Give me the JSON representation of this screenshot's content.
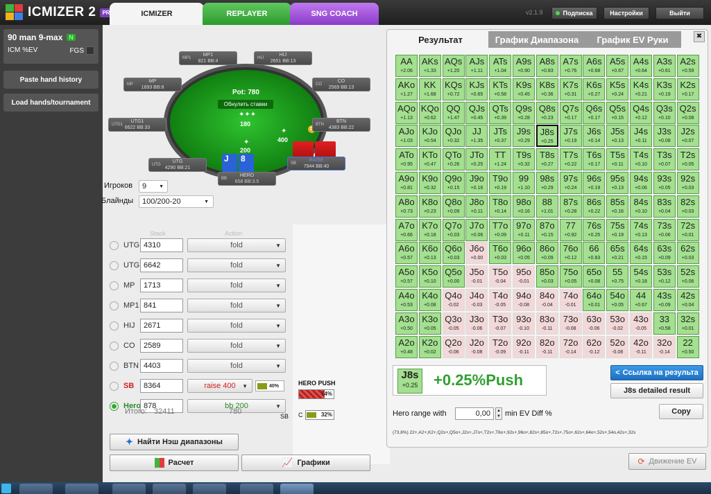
{
  "app": {
    "name": "ICMIZER 2",
    "badge": "PRO",
    "version": "v2.1.9"
  },
  "tabs": [
    "ICMIZER",
    "REPLAYER",
    "SNG COACH"
  ],
  "top_buttons": {
    "subscription": "Подписка",
    "settings": "Настройки",
    "logout": "Выйти"
  },
  "colors": {
    "green": "#4cb84c",
    "purple": "#a04fd8",
    "range_green": "#a3e08f",
    "push_text": "#2fa02f",
    "raise_red": "#d22020"
  },
  "sidebar": {
    "title": "90 man 9-max",
    "title_badge": "N",
    "sub_left": "ICM %EV",
    "sub_right": "FGS",
    "paste_button": "Paste hand history",
    "load_button": "Load hands/tournament"
  },
  "table": {
    "pot": "Pot: 780",
    "reset": "Обнулить ставки",
    "chips_center": "180",
    "chips_sb": "200",
    "chips_bb": "400",
    "dealer": "D",
    "seats": {
      "mp1": {
        "name": "MP1",
        "stack": "821 BB:4"
      },
      "hij": {
        "name": "HIJ",
        "stack": "2651 BB:13"
      },
      "mp": {
        "name": "MP",
        "stack": "1693 BB:8"
      },
      "co": {
        "name": "CO",
        "stack": "2569 BB:13"
      },
      "utg1": {
        "name": "UTG1",
        "stack": "6622 BB:33"
      },
      "btn": {
        "name": "BTN",
        "stack": "4383 BB:22"
      },
      "utg": {
        "name": "UTG",
        "stack": "4290 BB:21"
      },
      "sb": {
        "name": "RAISE",
        "stack": "7944 BB:40",
        "pos": "SB"
      },
      "hero": {
        "name": "HERO",
        "stack": "658 BB:3.5",
        "pos": "BB",
        "card1": "J",
        "card2": "8"
      }
    }
  },
  "settings": {
    "players_label": "Игроков",
    "players_value": "9",
    "blinds_label": "Блайнды",
    "blinds_value": "100/200-20"
  },
  "actions_table": {
    "stack_header": "Stack",
    "action_header": "Action",
    "rows": [
      {
        "pos": "UTG",
        "stack": "4310",
        "action": "fold"
      },
      {
        "pos": "UTG1",
        "stack": "6642",
        "action": "fold"
      },
      {
        "pos": "MP",
        "stack": "1713",
        "action": "fold"
      },
      {
        "pos": "MP1",
        "stack": "841",
        "action": "fold"
      },
      {
        "pos": "HIJ",
        "stack": "2671",
        "action": "fold"
      },
      {
        "pos": "CO",
        "stack": "2589",
        "action": "fold"
      },
      {
        "pos": "BTN",
        "stack": "4403",
        "action": "fold"
      },
      {
        "pos": "SB",
        "stack": "8364",
        "action": "raise 400",
        "pct": "40%"
      },
      {
        "pos": "Hero",
        "stack": "878",
        "action": "bb 200"
      }
    ],
    "total_label": "Итого:",
    "total_stack": "32411",
    "total_action": "780"
  },
  "hero_push": {
    "label": "HERO PUSH",
    "pct": "74%",
    "sb_label": "SB",
    "c_label": "C",
    "c_pct": "32%"
  },
  "buttons": {
    "nash": "Найти Нэш диапазоны",
    "calc": "Расчет",
    "graphs": "Графики",
    "ev_move": "Движение EV"
  },
  "panel": {
    "tabs": [
      "Результат",
      "График Диапазона",
      "График EV Руки"
    ],
    "close": "✖",
    "result_hand": "J8s",
    "result_hand_ev": "+0.25",
    "result_text": "+0.25%Push",
    "share_button": "Ссылка на результа",
    "detail_button": "J8s detailed result",
    "hero_range_label": "Hero range with",
    "hero_range_value": "0,00",
    "hero_range_suffix": "min EV Diff %",
    "copy_button": "Copy",
    "range_string": "(73,8%) 22+,A2+,K2+,Q2s+,Q5o+,J2s+,J7o+,T2s+,T6o+,92s+,96o+,82s+,85o+,72s+,75o+,62s+,64o+,52s+,54o,42s+,32s"
  },
  "grid": [
    [
      [
        "AA",
        "+2.06",
        1
      ],
      [
        "AKs",
        "+1.33",
        1
      ],
      [
        "AQs",
        "+1.20",
        1
      ],
      [
        "AJs",
        "+1.11",
        1
      ],
      [
        "ATs",
        "+1.04",
        1
      ],
      [
        "A9s",
        "+0.90",
        1
      ],
      [
        "A8s",
        "+0.83",
        1
      ],
      [
        "A7s",
        "+0.76",
        1
      ],
      [
        "A6s",
        "+0.68",
        1
      ],
      [
        "A5s",
        "+0.67",
        1
      ],
      [
        "A4s",
        "+0.64",
        1
      ],
      [
        "A3s",
        "+0.61",
        1
      ],
      [
        "A2s",
        "+0.59",
        1
      ]
    ],
    [
      [
        "AKo",
        "+1.27",
        1
      ],
      [
        "KK",
        "+1.68",
        1
      ],
      [
        "KQs",
        "+0.72",
        1
      ],
      [
        "KJs",
        "+0.65",
        1
      ],
      [
        "KTs",
        "+0.58",
        1
      ],
      [
        "K9s",
        "+0.45",
        1
      ],
      [
        "K8s",
        "+0.36",
        1
      ],
      [
        "K7s",
        "+0.31",
        1
      ],
      [
        "K6s",
        "+0.27",
        1
      ],
      [
        "K5s",
        "+0.24",
        1
      ],
      [
        "K4s",
        "+0.21",
        1
      ],
      [
        "K3s",
        "+0.19",
        1
      ],
      [
        "K2s",
        "+0.17",
        1
      ]
    ],
    [
      [
        "AQo",
        "+1.13",
        1
      ],
      [
        "KQo",
        "+0.62",
        1
      ],
      [
        "QQ",
        "+1.47",
        1
      ],
      [
        "QJs",
        "+0.45",
        1
      ],
      [
        "QTs",
        "+0.39",
        1
      ],
      [
        "Q9s",
        "+0.28",
        1
      ],
      [
        "Q8s",
        "+0.23",
        1
      ],
      [
        "Q7s",
        "+0.17",
        1
      ],
      [
        "Q6s",
        "+0.17",
        1
      ],
      [
        "Q5s",
        "+0.15",
        1
      ],
      [
        "Q4s",
        "+0.12",
        1
      ],
      [
        "Q3s",
        "+0.10",
        1
      ],
      [
        "Q2s",
        "+0.08",
        1
      ]
    ],
    [
      [
        "AJo",
        "+1.03",
        1
      ],
      [
        "KJo",
        "+0.54",
        1
      ],
      [
        "QJo",
        "+0.32",
        1
      ],
      [
        "JJ",
        "+1.35",
        1
      ],
      [
        "JTs",
        "+0.37",
        1
      ],
      [
        "J9s",
        "+0.29",
        1
      ],
      [
        "J8s",
        "+0.25",
        1
      ],
      [
        "J7s",
        "+0.19",
        1
      ],
      [
        "J6s",
        "+0.14",
        1
      ],
      [
        "J5s",
        "+0.13",
        1
      ],
      [
        "J4s",
        "+0.11",
        1
      ],
      [
        "J3s",
        "+0.08",
        1
      ],
      [
        "J2s",
        "+0.07",
        1
      ]
    ],
    [
      [
        "ATo",
        "+0.95",
        1
      ],
      [
        "KTo",
        "+0.47",
        1
      ],
      [
        "QTo",
        "+0.26",
        1
      ],
      [
        "JTo",
        "+0.25",
        1
      ],
      [
        "TT",
        "+1.24",
        1
      ],
      [
        "T9s",
        "+0.32",
        1
      ],
      [
        "T8s",
        "+0.27",
        1
      ],
      [
        "T7s",
        "+0.22",
        1
      ],
      [
        "T6s",
        "+0.17",
        1
      ],
      [
        "T5s",
        "+0.11",
        1
      ],
      [
        "T4s",
        "+0.10",
        1
      ],
      [
        "T3s",
        "+0.07",
        1
      ],
      [
        "T2s",
        "+0.05",
        1
      ]
    ],
    [
      [
        "A9o",
        "+0.81",
        1
      ],
      [
        "K9o",
        "+0.32",
        1
      ],
      [
        "Q9o",
        "+0.15",
        1
      ],
      [
        "J9o",
        "+0.16",
        1
      ],
      [
        "T9o",
        "+0.19",
        1
      ],
      [
        "99",
        "+1.10",
        1
      ],
      [
        "98s",
        "+0.29",
        1
      ],
      [
        "97s",
        "+0.24",
        1
      ],
      [
        "96s",
        "+0.19",
        1
      ],
      [
        "95s",
        "+0.13",
        1
      ],
      [
        "94s",
        "+0.06",
        1
      ],
      [
        "93s",
        "+0.05",
        1
      ],
      [
        "92s",
        "+0.03",
        1
      ]
    ],
    [
      [
        "A8o",
        "+0.73",
        1
      ],
      [
        "K8o",
        "+0.23",
        1
      ],
      [
        "Q8o",
        "+0.09",
        1
      ],
      [
        "J8o",
        "+0.11",
        1
      ],
      [
        "T8o",
        "+0.14",
        1
      ],
      [
        "98o",
        "+0.16",
        1
      ],
      [
        "88",
        "+1.01",
        1
      ],
      [
        "87s",
        "+0.28",
        1
      ],
      [
        "86s",
        "+0.22",
        1
      ],
      [
        "85s",
        "+0.16",
        1
      ],
      [
        "84s",
        "+0.10",
        1
      ],
      [
        "83s",
        "+0.04",
        1
      ],
      [
        "82s",
        "+0.03",
        1
      ]
    ],
    [
      [
        "A7o",
        "+0.66",
        1
      ],
      [
        "K7o",
        "+0.18",
        1
      ],
      [
        "Q7o",
        "+0.03",
        1
      ],
      [
        "J7o",
        "+0.06",
        1
      ],
      [
        "T7o",
        "+0.09",
        1
      ],
      [
        "97o",
        "+0.11",
        1
      ],
      [
        "87o",
        "+0.15",
        1
      ],
      [
        "77",
        "+0.92",
        1
      ],
      [
        "76s",
        "+0.25",
        1
      ],
      [
        "75s",
        "+0.19",
        1
      ],
      [
        "74s",
        "+0.13",
        1
      ],
      [
        "73s",
        "+0.06",
        1
      ],
      [
        "72s",
        "+0.01",
        1
      ]
    ],
    [
      [
        "A6o",
        "+0.57",
        1
      ],
      [
        "K6o",
        "+0.13",
        1
      ],
      [
        "Q6o",
        "+0.03",
        1
      ],
      [
        "J6o",
        "+0.00",
        0
      ],
      [
        "T6o",
        "+0.03",
        1
      ],
      [
        "96o",
        "+0.05",
        1
      ],
      [
        "86o",
        "+0.09",
        1
      ],
      [
        "76o",
        "+0.12",
        1
      ],
      [
        "66",
        "+0.83",
        1
      ],
      [
        "65s",
        "+0.21",
        1
      ],
      [
        "64s",
        "+0.15",
        1
      ],
      [
        "63s",
        "+0.09",
        1
      ],
      [
        "62s",
        "+0.03",
        1
      ]
    ],
    [
      [
        "A5o",
        "+0.57",
        1
      ],
      [
        "K5o",
        "+0.10",
        1
      ],
      [
        "Q5o",
        "+0.00",
        1
      ],
      [
        "J5o",
        "-0.01",
        0
      ],
      [
        "T5o",
        "-0.04",
        0
      ],
      [
        "95o",
        "-0.01",
        0
      ],
      [
        "85o",
        "+0.03",
        1
      ],
      [
        "75o",
        "+0.05",
        1
      ],
      [
        "65o",
        "+0.08",
        1
      ],
      [
        "55",
        "+0.75",
        1
      ],
      [
        "54s",
        "+0.18",
        1
      ],
      [
        "53s",
        "+0.12",
        1
      ],
      [
        "52s",
        "+0.06",
        1
      ]
    ],
    [
      [
        "A4o",
        "+0.53",
        1
      ],
      [
        "K4o",
        "+0.08",
        1
      ],
      [
        "Q4o",
        "-0.02",
        0
      ],
      [
        "J4o",
        "-0.03",
        0
      ],
      [
        "T4o",
        "-0.05",
        0
      ],
      [
        "94o",
        "-0.08",
        0
      ],
      [
        "84o",
        "-0.04",
        0
      ],
      [
        "74o",
        "-0.01",
        0
      ],
      [
        "64o",
        "+0.01",
        1
      ],
      [
        "54o",
        "+0.05",
        1
      ],
      [
        "44",
        "+0.67",
        1
      ],
      [
        "43s",
        "+0.09",
        1
      ],
      [
        "42s",
        "+0.04",
        1
      ]
    ],
    [
      [
        "A3o",
        "+0.50",
        1
      ],
      [
        "K3o",
        "+0.05",
        1
      ],
      [
        "Q3o",
        "-0.05",
        0
      ],
      [
        "J3o",
        "-0.06",
        0
      ],
      [
        "T3o",
        "-0.07",
        0
      ],
      [
        "93o",
        "-0.10",
        0
      ],
      [
        "83o",
        "-0.11",
        0
      ],
      [
        "73o",
        "-0.08",
        0
      ],
      [
        "63o",
        "-0.06",
        0
      ],
      [
        "53o",
        "-0.02",
        0
      ],
      [
        "43o",
        "-0.05",
        0
      ],
      [
        "33",
        "+0.58",
        1
      ],
      [
        "32s",
        "+0.01",
        1
      ]
    ],
    [
      [
        "A2o",
        "+0.48",
        1
      ],
      [
        "K2o",
        "+0.02",
        1
      ],
      [
        "Q2o",
        "-0.06",
        0
      ],
      [
        "J2o",
        "-0.08",
        0
      ],
      [
        "T2o",
        "-0.09",
        0
      ],
      [
        "92o",
        "-0.11",
        0
      ],
      [
        "82o",
        "-0.11",
        0
      ],
      [
        "72o",
        "-0.14",
        0
      ],
      [
        "62o",
        "-0.12",
        0
      ],
      [
        "52o",
        "-0.08",
        0
      ],
      [
        "42o",
        "-0.11",
        0
      ],
      [
        "32o",
        "-0.14",
        0
      ],
      [
        "22",
        "+0.50",
        1
      ]
    ]
  ]
}
